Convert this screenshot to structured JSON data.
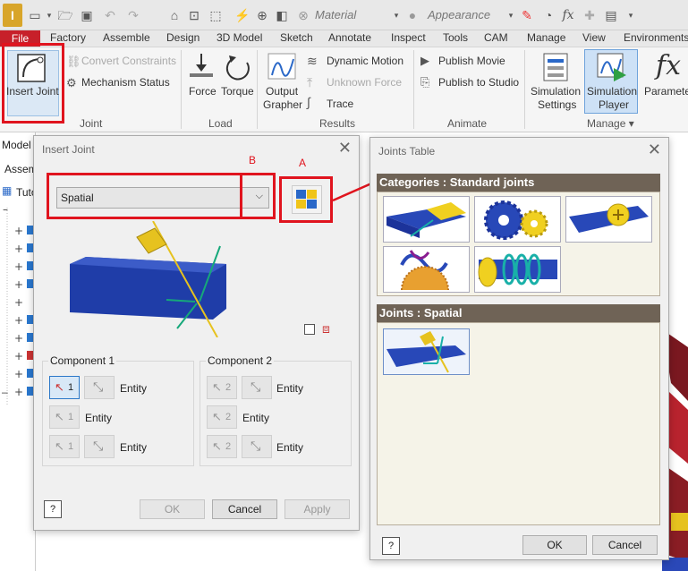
{
  "qat": {
    "material": "Material",
    "appearance": "Appearance",
    "fx_glyph": "fx"
  },
  "ribbon_tabs": [
    "File",
    "Factory",
    "Assemble",
    "Design",
    "3D Model",
    "Sketch",
    "Annotate",
    "Inspect",
    "Tools",
    "CAM",
    "Manage",
    "View",
    "Environments"
  ],
  "ribbon": {
    "insert_joint": "Insert Joint",
    "convert_constraints": "Convert Constraints",
    "mechanism_status": "Mechanism Status",
    "group_joint": "Joint",
    "force": "Force",
    "torque": "Torque",
    "group_load": "Load",
    "output_grapher_1": "Output",
    "output_grapher_2": "Grapher",
    "dynamic_motion": "Dynamic Motion",
    "unknown_force": "Unknown Force",
    "trace": "Trace",
    "group_results": "Results",
    "publish_movie": "Publish Movie",
    "publish_to_studio": "Publish to Studio",
    "group_animate": "Animate",
    "simulation_settings_1": "Simulation",
    "simulation_settings_2": "Settings",
    "simulation_player_1": "Simulation",
    "simulation_player_2": "Player",
    "parameters": "Parameters",
    "group_manage": "Manage ▾"
  },
  "browser": {
    "model": "Model",
    "assemble": "Assemb",
    "tuto": "Tuto"
  },
  "insert_joint": {
    "title": "Insert Joint",
    "joint_type": "Spatial",
    "component1": "Component 1",
    "component2": "Component 2",
    "entity": "Entity",
    "sel_num_1": "1",
    "sel_num_2": "2",
    "ok": "OK",
    "cancel": "Cancel",
    "apply": "Apply"
  },
  "annotations": {
    "a": "A",
    "b": "B"
  },
  "joints_table": {
    "title": "Joints Table",
    "categories": "Categories : Standard joints",
    "joints": "Joints : Spatial",
    "ok": "OK",
    "cancel": "Cancel"
  },
  "colors": {
    "accent_red": "#e0141e",
    "file_tab": "#c7202a",
    "header_brown": "#6f6356",
    "part_blue": "#1f3da8"
  }
}
